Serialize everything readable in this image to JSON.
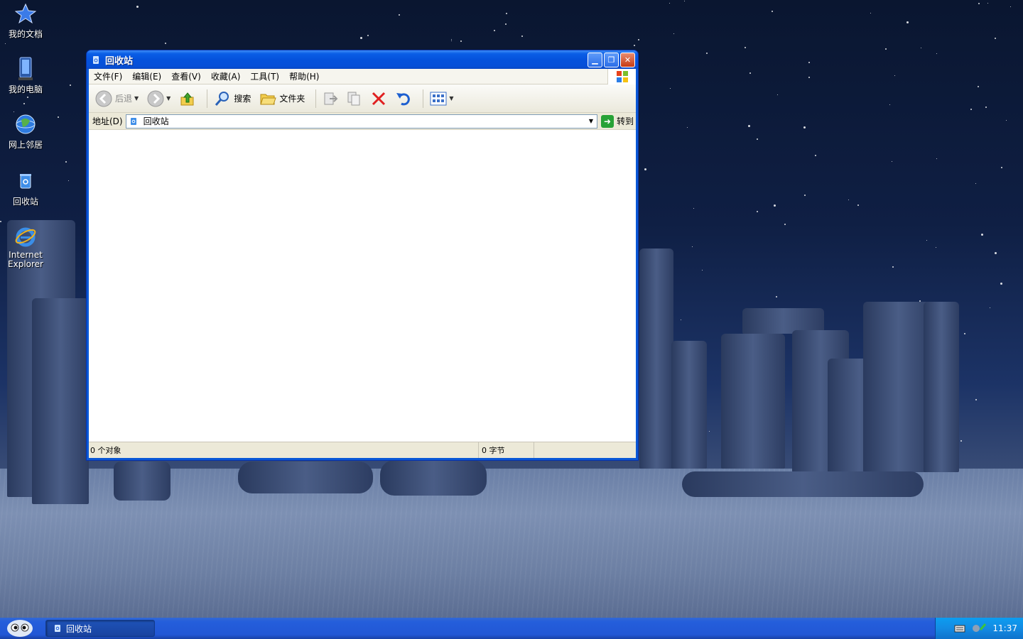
{
  "desktop": {
    "icons": [
      {
        "label": "我的文档",
        "icon": "my-documents-icon"
      },
      {
        "label": "我的电脑",
        "icon": "my-computer-icon"
      },
      {
        "label": "网上邻居",
        "icon": "network-icon"
      },
      {
        "label": "回收站",
        "icon": "recycle-bin-icon"
      },
      {
        "label": "Internet Explorer",
        "icon": "ie-icon"
      }
    ]
  },
  "window": {
    "title": "回收站",
    "menu": [
      "文件(F)",
      "编辑(E)",
      "查看(V)",
      "收藏(A)",
      "工具(T)",
      "帮助(H)"
    ],
    "toolbar": {
      "back_label": "后退",
      "search_label": "搜索",
      "folders_label": "文件夹"
    },
    "address": {
      "label": "地址(D)",
      "value": "回收站",
      "go_label": "转到"
    },
    "status": {
      "objects": "0 个对象",
      "bytes": "0 字节"
    }
  },
  "taskbar": {
    "task_label": "回收站",
    "clock": "11:37"
  },
  "colors": {
    "titlebar": "#0552dc",
    "taskbar": "#245edb",
    "tray": "#138be3",
    "delete_red": "#e02020"
  }
}
